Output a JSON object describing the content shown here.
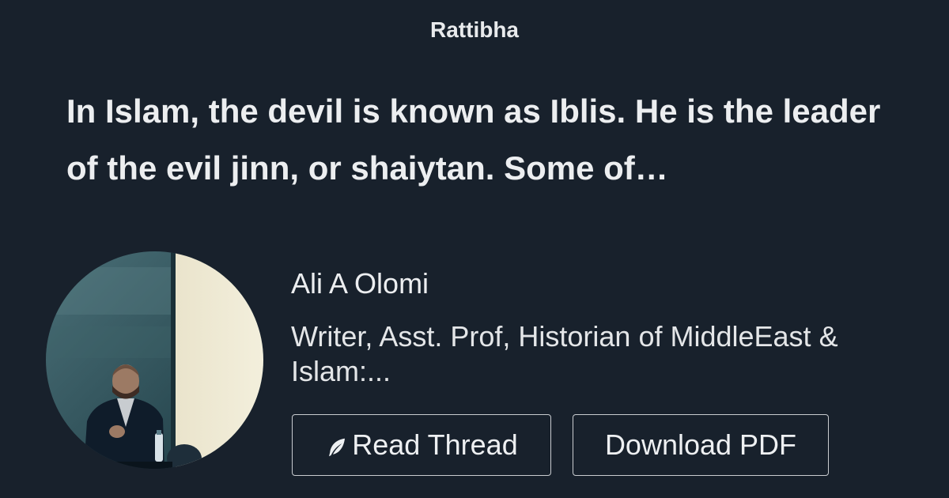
{
  "site": {
    "name": "Rattibha"
  },
  "thread": {
    "title": "In Islam, the devil is known as Iblis. He is the leader of the evil jinn, or shaiytan. Some of…"
  },
  "author": {
    "name": "Ali A Olomi",
    "bio": "Writer, Asst. Prof, Historian of MiddleEast & Islam:..."
  },
  "actions": {
    "read_label": "Read Thread",
    "read_icon": "feather-icon",
    "download_label": "Download PDF"
  },
  "colors": {
    "background": "#18212c",
    "text": "#ebedef",
    "button_border": "#c9ccd0"
  }
}
